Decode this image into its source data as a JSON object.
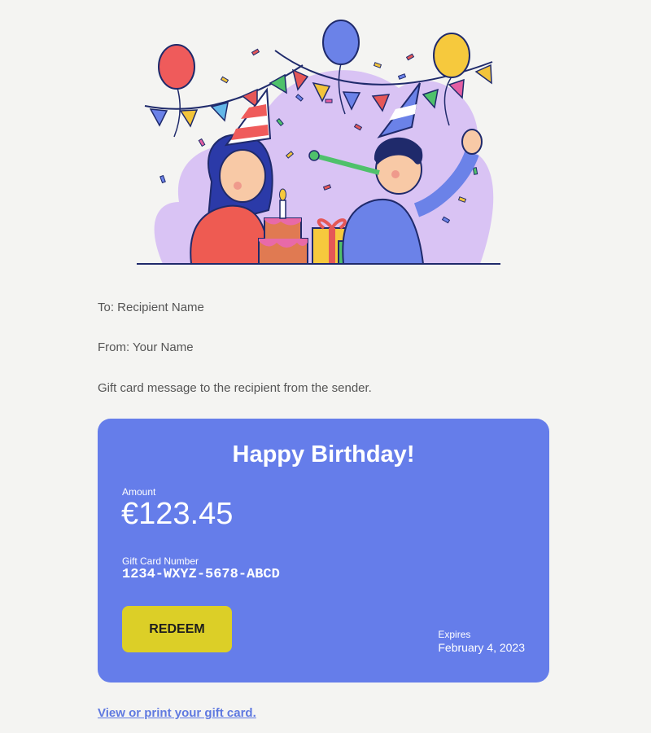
{
  "email": {
    "to_line": "To: Recipient Name",
    "from_line": "From: Your Name",
    "message": "Gift card message to the recipient from the sender."
  },
  "card": {
    "title": "Happy Birthday!",
    "amount_label": "Amount",
    "amount_value": "€123.45",
    "number_label": "Gift Card Number",
    "number_value": "1234-WXYZ-5678-ABCD",
    "redeem_label": "REDEEM",
    "expires_label": "Expires",
    "expires_date": "February 4, 2023"
  },
  "link": {
    "label": "View or print your gift card."
  },
  "illustration": {
    "icon": "birthday-party-illustration"
  },
  "colors": {
    "card_bg": "#657dea",
    "redeem_bg": "#dccf27",
    "link": "#5f79e0",
    "page_bg": "#f4f4f2"
  }
}
